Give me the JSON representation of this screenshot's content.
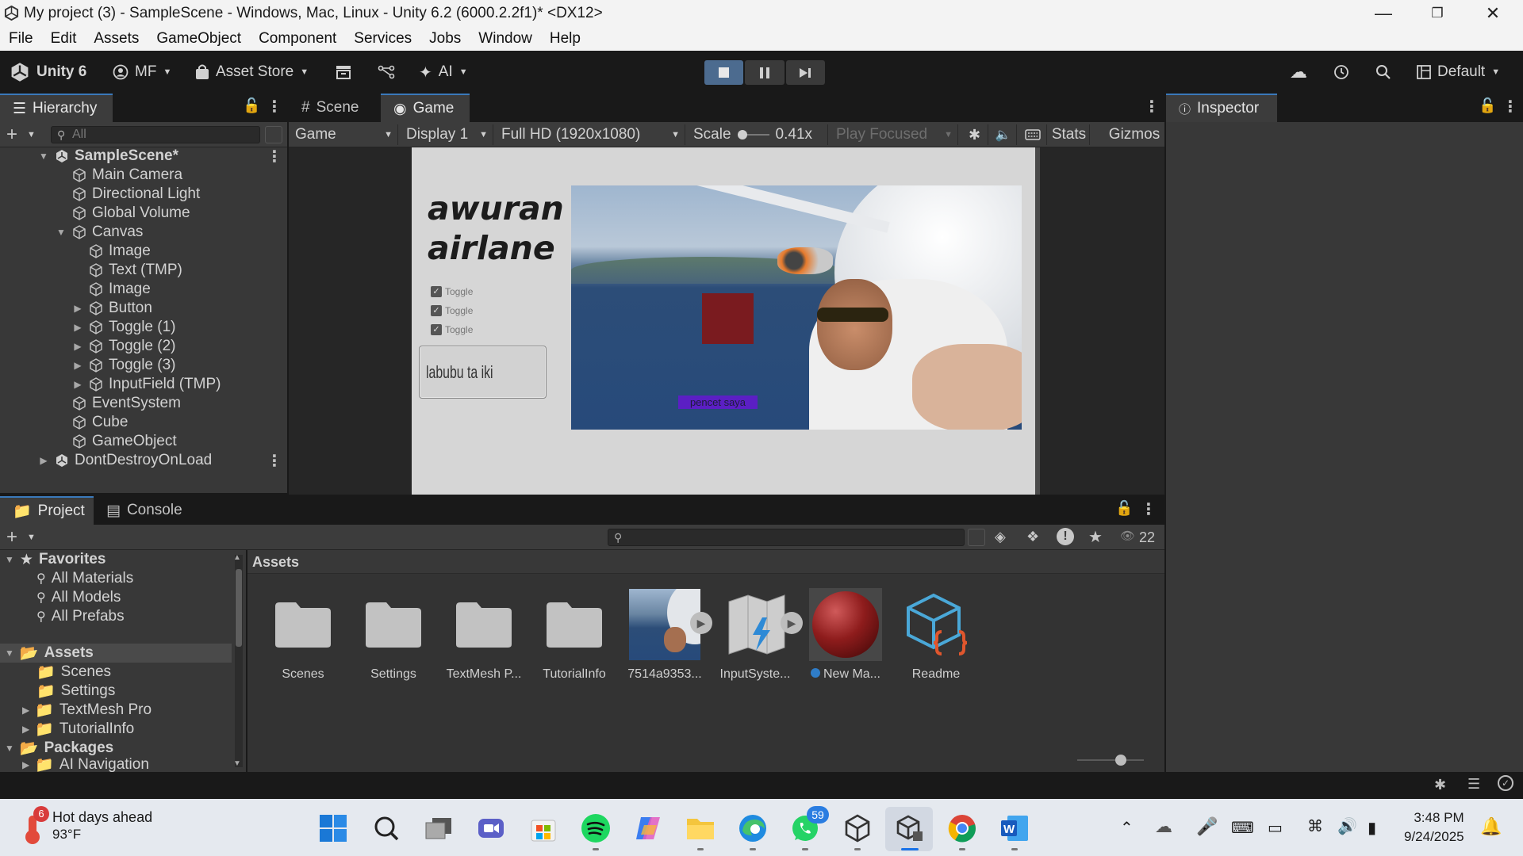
{
  "window": {
    "title": "My project (3) - SampleScene - Windows, Mac, Linux - Unity 6.2 (6000.2.2f1)* <DX12>"
  },
  "menu": [
    "File",
    "Edit",
    "Assets",
    "GameObject",
    "Component",
    "Services",
    "Jobs",
    "Window",
    "Help"
  ],
  "toolbar": {
    "unity_label": "Unity 6",
    "account": "MF",
    "asset_store": "Asset Store",
    "ai": "AI",
    "layout": "Default"
  },
  "hierarchy": {
    "tab": "Hierarchy",
    "search_placeholder": "All",
    "items": [
      {
        "label": "SampleScene*"
      },
      {
        "label": "Main Camera"
      },
      {
        "label": "Directional Light"
      },
      {
        "label": "Global Volume"
      },
      {
        "label": "Canvas"
      },
      {
        "label": "Image"
      },
      {
        "label": "Text (TMP)"
      },
      {
        "label": "Image"
      },
      {
        "label": "Button"
      },
      {
        "label": "Toggle (1)"
      },
      {
        "label": "Toggle (2)"
      },
      {
        "label": "Toggle (3)"
      },
      {
        "label": "InputField (TMP)"
      },
      {
        "label": "EventSystem"
      },
      {
        "label": "Cube"
      },
      {
        "label": "GameObject"
      },
      {
        "label": "DontDestroyOnLoad"
      }
    ]
  },
  "scene_tabs": {
    "scene": "Scene",
    "game": "Game"
  },
  "game_toolbar": {
    "mode": "Game",
    "display": "Display 1",
    "resolution": "Full HD (1920x1080)",
    "scale_label": "Scale",
    "scale_value": "0.41x",
    "play_focus": "Play Focused",
    "stats": "Stats",
    "gizmos": "Gizmos"
  },
  "game_view": {
    "title_line1": "awuran",
    "title_line2": "airlane",
    "toggles": [
      "Toggle",
      "Toggle",
      "Toggle"
    ],
    "input_text": "labubu ta iki",
    "button_text": "pencet saya"
  },
  "inspector": {
    "tab": "Inspector"
  },
  "project": {
    "tab_project": "Project",
    "tab_console": "Console",
    "visible_count": "22",
    "breadcrumb": "Assets",
    "tree": {
      "favorites": "Favorites",
      "favorites_items": [
        "All Materials",
        "All Models",
        "All Prefabs"
      ],
      "assets": "Assets",
      "assets_items": [
        "Scenes",
        "Settings",
        "TextMesh Pro",
        "TutorialInfo"
      ],
      "packages": "Packages",
      "packages_items": [
        "AI Navigation"
      ]
    },
    "assets": [
      {
        "label": "Scenes",
        "icon": "folder-icon"
      },
      {
        "label": "Settings",
        "icon": "folder-icon"
      },
      {
        "label": "TextMesh P...",
        "icon": "folder-icon"
      },
      {
        "label": "TutorialInfo",
        "icon": "folder-icon"
      },
      {
        "label": "7514a9353...",
        "icon": "image-thumbnail"
      },
      {
        "label": "InputSyste...",
        "icon": "input-actions-icon"
      },
      {
        "label": "New Ma...",
        "icon": "material-sphere"
      },
      {
        "label": "Readme",
        "icon": "readme-icon"
      }
    ]
  },
  "taskbar": {
    "weather_badge": "6",
    "weather_title": "Hot days ahead",
    "weather_temp": "93°F",
    "whatsapp_badge": "59",
    "time": "3:48 PM",
    "date": "9/24/2025"
  },
  "colors": {
    "accent": "#3a79bb",
    "panel": "#383838",
    "play_active": "#4c6b8f",
    "ui_button": "#5b1fc4",
    "red_image": "#7a1b1f"
  }
}
